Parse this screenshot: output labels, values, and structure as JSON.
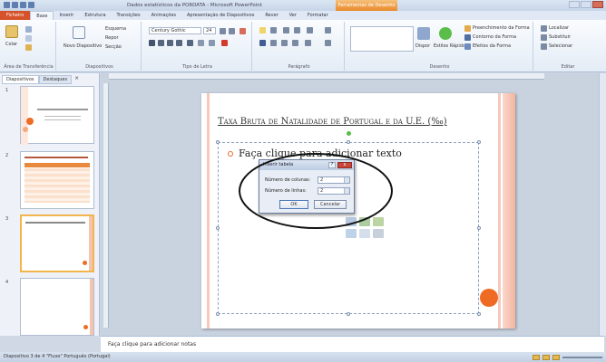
{
  "window": {
    "title": "Dados estatísticos da PORDATA - Microsoft PowerPoint",
    "contextual_tab": "Ferramentas de Desenho"
  },
  "ribbon_tabs": [
    "Ficheiro",
    "Base",
    "Inserir",
    "Estrutura",
    "Transições",
    "Animações",
    "Apresentação de Diapositivos",
    "Rever",
    "Ver",
    "Formatar"
  ],
  "ribbon": {
    "clipboard": {
      "label": "Área de Transferência",
      "paste": "Colar"
    },
    "slides": {
      "label": "Diapositivos",
      "new_slide": "Novo Diapositivo",
      "layout": "Esquema",
      "reset": "Repor",
      "section": "Secção"
    },
    "font": {
      "label": "Tipo de Letra",
      "font_name": "Century Gothic",
      "font_size": "24"
    },
    "paragraph": {
      "label": "Parágrafo"
    },
    "drawing": {
      "label": "Desenho",
      "arrange": "Dispor",
      "quick_styles": "Estilos Rápidos",
      "shape_fill": "Preenchimento da Forma",
      "shape_outline": "Contorno da Forma",
      "shape_effects": "Efeitos da Forma"
    },
    "editing": {
      "label": "Editar",
      "find": "Localizar",
      "replace": "Substituir",
      "select": "Selecionar"
    }
  },
  "panel": {
    "tabs": [
      "Diapositivos",
      "Destaques"
    ],
    "slide_numbers": [
      "1",
      "2",
      "3",
      "4"
    ]
  },
  "slide": {
    "title": "Taxa Bruta de Natalidade de Portugal e da U.E. (‰)",
    "placeholder": "Faça clique para adicionar texto"
  },
  "dialog": {
    "title": "Inserir tabela",
    "help": "?",
    "close": "x",
    "columns_label": "Número de colunas:",
    "columns_value": "2",
    "rows_label": "Número de linhas:",
    "rows_value": "2",
    "ok": "OK",
    "cancel": "Cancelar"
  },
  "notes": {
    "placeholder": "Faça clique para adicionar notas"
  },
  "status": {
    "text": "Diapositivo 3 de 4   \"Fluxo\"   Português (Portugal)"
  },
  "colors": {
    "accent": "#ef6b24",
    "file_tab": "#d5522a",
    "contextual": "#e98a2a"
  }
}
